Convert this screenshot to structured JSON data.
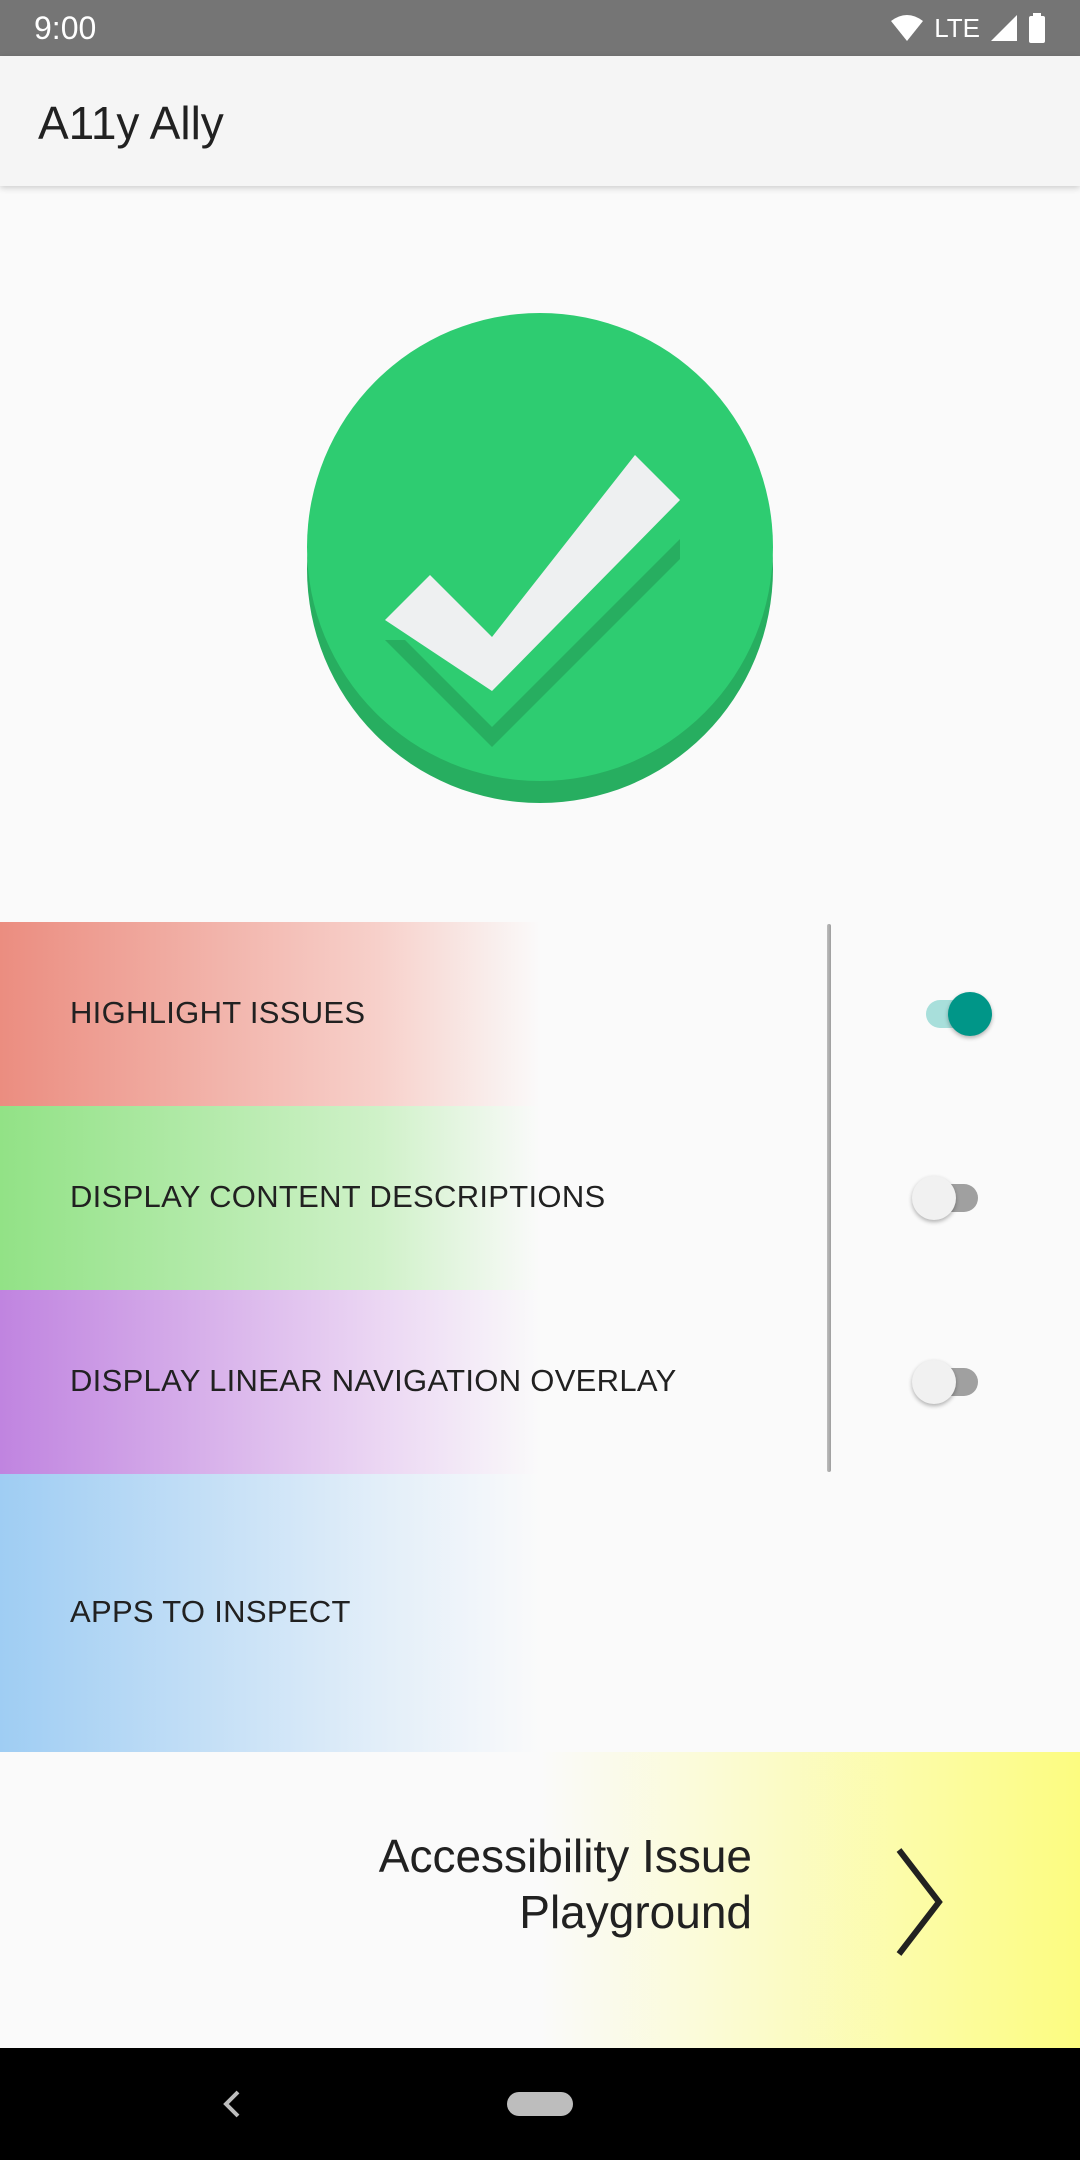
{
  "status_bar": {
    "time": "9:00",
    "network": "LTE",
    "icons": [
      "wifi-icon",
      "cell-signal-icon",
      "battery-icon"
    ]
  },
  "app_bar": {
    "title": "A11y Ally"
  },
  "hero": {
    "icon": "checkmark-circle-icon",
    "color": "#2ecc71"
  },
  "settings": {
    "highlight": {
      "label": "HIGHLIGHT ISSUES",
      "enabled": true
    },
    "content_desc": {
      "label": "DISPLAY CONTENT DESCRIPTIONS",
      "enabled": false
    },
    "linear_nav": {
      "label": "DISPLAY LINEAR NAVIGATION OVERLAY",
      "enabled": false
    }
  },
  "apps_to_inspect": {
    "label": "APPS TO INSPECT"
  },
  "playground": {
    "line1": "Accessibility Issue",
    "line2": "Playground",
    "icon": "chevron-right-icon"
  },
  "nav_bar": {
    "icons": [
      "back-icon",
      "home-pill-icon"
    ]
  },
  "colors": {
    "accent": "#009688",
    "highlight_row": "#eb8d80",
    "content_row": "#92e286",
    "linear_row": "#c084e0",
    "apps_row": "#9fcdf3",
    "playground_row": "#fcfc80"
  }
}
